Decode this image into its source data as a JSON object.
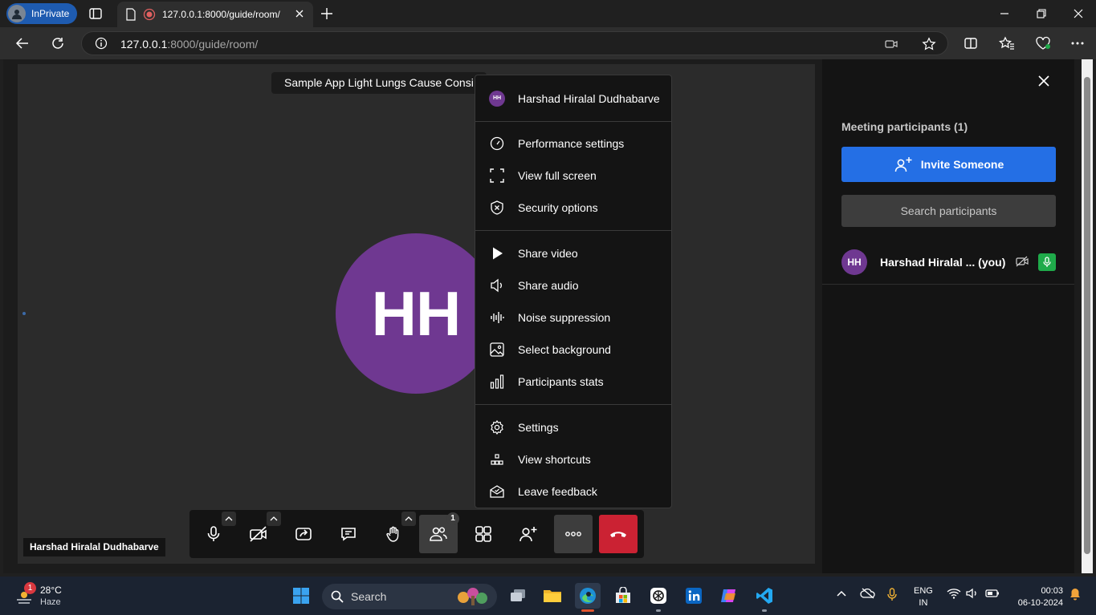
{
  "browser": {
    "inprivate_label": "InPrivate",
    "tab_title": "127.0.0.1:8000/guide/room/",
    "url_host": "127.0.0.1",
    "url_rest": ":8000/guide/room/"
  },
  "meeting": {
    "subject": "Sample App Light Lungs Cause Consi",
    "avatar_initials": "HH",
    "local_name_tag": "Harshad Hiralal Dudhabarve",
    "participants_badge": "1"
  },
  "menu": {
    "user_initials": "HH",
    "user_name": "Harshad Hiralal Dudhabarve",
    "items": [
      {
        "label": "Performance settings"
      },
      {
        "label": "View full screen"
      },
      {
        "label": "Security options"
      },
      {
        "label": "Share video"
      },
      {
        "label": "Share audio"
      },
      {
        "label": "Noise suppression"
      },
      {
        "label": "Select background"
      },
      {
        "label": "Participants stats"
      },
      {
        "label": "Settings"
      },
      {
        "label": "View shortcuts"
      },
      {
        "label": "Leave feedback"
      }
    ]
  },
  "panel": {
    "title": "Meeting participants (1)",
    "invite_label": "Invite Someone",
    "search_placeholder": "Search participants",
    "participant_initials": "HH",
    "participant_name": "Harshad Hiralal ... (you)"
  },
  "taskbar": {
    "weather_badge": "1",
    "temperature": "28°C",
    "condition": "Haze",
    "search_label": "Search",
    "lang_1": "ENG",
    "lang_2": "IN",
    "time": "00:03",
    "date": "06-10-2024"
  },
  "colors": {
    "accent_blue": "#246fe5",
    "avatar_purple": "#6f3891",
    "hangup_red": "#cb2233",
    "mic_green": "#1faa4a"
  }
}
